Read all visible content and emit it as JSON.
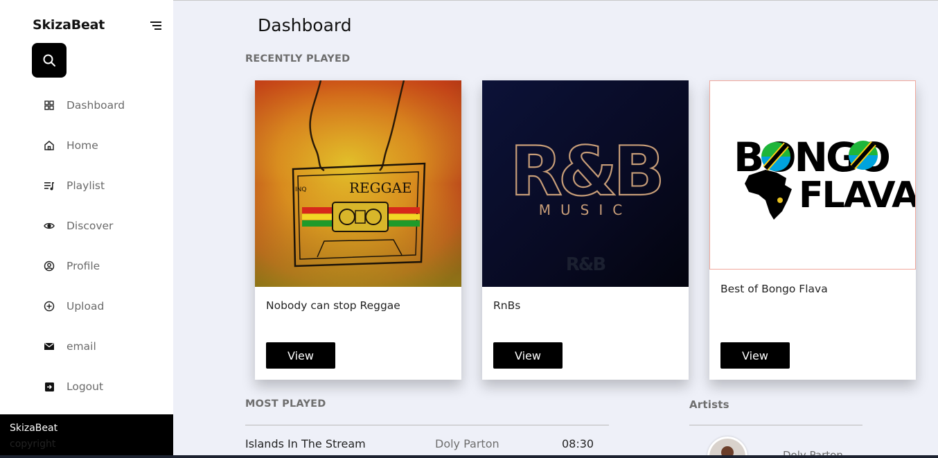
{
  "sidebar": {
    "brand": "SkizaBeat",
    "nav": [
      {
        "label": "Dashboard",
        "icon": "grid-icon"
      },
      {
        "label": "Home",
        "icon": "home-icon"
      },
      {
        "label": "Playlist",
        "icon": "playlist-icon"
      },
      {
        "label": "Discover",
        "icon": "eye-icon"
      },
      {
        "label": "Profile",
        "icon": "user-circle-icon"
      },
      {
        "label": "Upload",
        "icon": "plus-circle-icon"
      },
      {
        "label": "email",
        "icon": "envelope-icon"
      },
      {
        "label": "Logout",
        "icon": "logout-icon"
      }
    ],
    "footer": {
      "brand": "SkizaBeat",
      "copyright": "copyright"
    }
  },
  "main": {
    "title": "Dashboard",
    "recently_played_label": "RECENTLY PLAYED",
    "cards": [
      {
        "title": "Nobody can stop Reggae",
        "button": "View",
        "art_text": "REGGAE",
        "art_small": "INQ"
      },
      {
        "title": "RnBs",
        "button": "View",
        "art_text": "R&B",
        "art_sub": "MUSIC",
        "art_small": "R&B"
      },
      {
        "title": "Best of Bongo Flava",
        "button": "View",
        "art_line1": "BONGO",
        "art_line2": "FLAVA"
      }
    ],
    "most_played_label": "MOST PLAYED",
    "songs": [
      {
        "title": "Islands In The Stream",
        "artist": "Doly Parton",
        "duration": "08:30"
      }
    ],
    "artists_label": "Artists",
    "artists": [
      {
        "name": "Doly Parton"
      }
    ]
  },
  "colors": {
    "background": "#eef0f8",
    "sidebar": "#ffffff",
    "accent": "#000000",
    "muted_text": "#6e6e6e"
  }
}
